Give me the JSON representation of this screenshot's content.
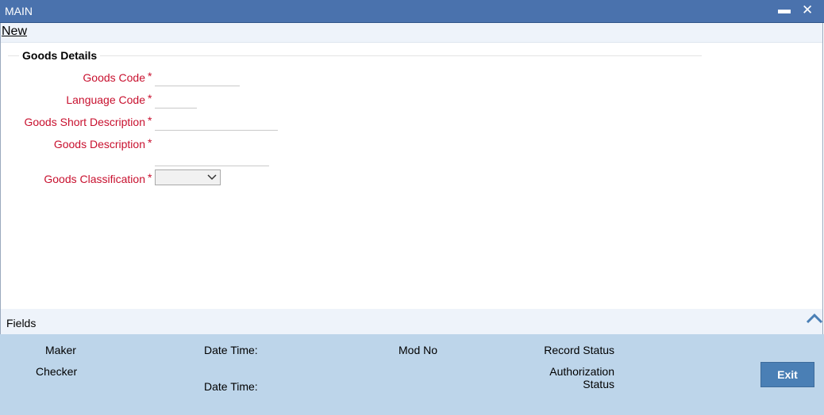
{
  "window": {
    "title": "MAIN",
    "minimize_glyph": "▬",
    "close_glyph": "✕"
  },
  "menu": {
    "new_label": "New"
  },
  "section": {
    "title": "Goods Details"
  },
  "form": {
    "goods_code_label": "Goods Code",
    "language_code_label": "Language Code",
    "goods_short_desc_label": "Goods Short Description",
    "goods_desc_label": "Goods Description",
    "goods_classification_label": "Goods Classification",
    "required_mark": "*",
    "goods_code_value": "",
    "language_code_value": "",
    "goods_short_desc_value": "",
    "goods_desc_value": "",
    "goods_classification_value": ""
  },
  "fields_bar": {
    "label": "Fields",
    "icon": "chevron-up-icon"
  },
  "audit": {
    "maker_label": "Maker",
    "checker_label": "Checker",
    "date_time_label": "Date Time:",
    "mod_no_label": "Mod No",
    "record_status_label": "Record Status",
    "authorization_label": "Authorization",
    "status_label": "Status"
  },
  "buttons": {
    "exit_label": "Exit"
  },
  "colors": {
    "titlebar": "#4a72ad",
    "required": "#c8102e",
    "footer": "#bdd5ea",
    "exit_button": "#4a7fb5"
  }
}
